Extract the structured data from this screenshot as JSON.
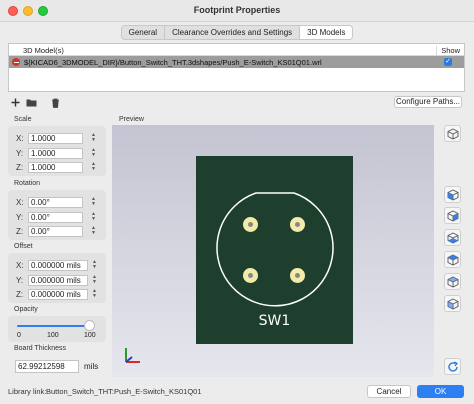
{
  "window": {
    "title": "Footprint Properties"
  },
  "tabs": [
    "General",
    "Clearance Overrides and Settings",
    "3D Models"
  ],
  "model_list": {
    "col_model": "3D Model(s)",
    "col_show": "Show",
    "rows": [
      {
        "path": "${KICAD6_3DMODEL_DIR}/Button_Switch_THT.3dshapes/Push_E-Switch_KS01Q01.wrl",
        "show": true
      }
    ]
  },
  "configure_paths": "Configure Paths...",
  "scale": {
    "label": "Scale",
    "x_label": "X:",
    "y_label": "Y:",
    "z_label": "Z:",
    "x": "1.0000",
    "y": "1.0000",
    "z": "1.0000"
  },
  "rotation": {
    "label": "Rotation",
    "x_label": "X:",
    "y_label": "Y:",
    "z_label": "Z:",
    "x": "0.00°",
    "y": "0.00°",
    "z": "0.00°"
  },
  "offset": {
    "label": "Offset",
    "x_label": "X:",
    "y_label": "Y:",
    "z_label": "Z:",
    "x": "0.000000 mils",
    "y": "0.000000 mils",
    "z": "0.000000 mils"
  },
  "opacity": {
    "label": "Opacity",
    "min": "0",
    "mid": "100",
    "max": "100",
    "value": 100
  },
  "board_thickness": {
    "label": "Board Thickness",
    "value": "62.99212598",
    "unit": "mils"
  },
  "preview": {
    "label": "Preview",
    "reference": "SW1"
  },
  "footer": {
    "library_label": "Library link:",
    "library_value": "Button_Switch_THT:Push_E-Switch_KS01Q01",
    "cancel": "Cancel",
    "ok": "OK"
  },
  "colors": {
    "accent": "#2e7ff1",
    "pcb": "#1e3e2e",
    "pad": "#f2eca8",
    "selection": "#9d9d9d"
  }
}
